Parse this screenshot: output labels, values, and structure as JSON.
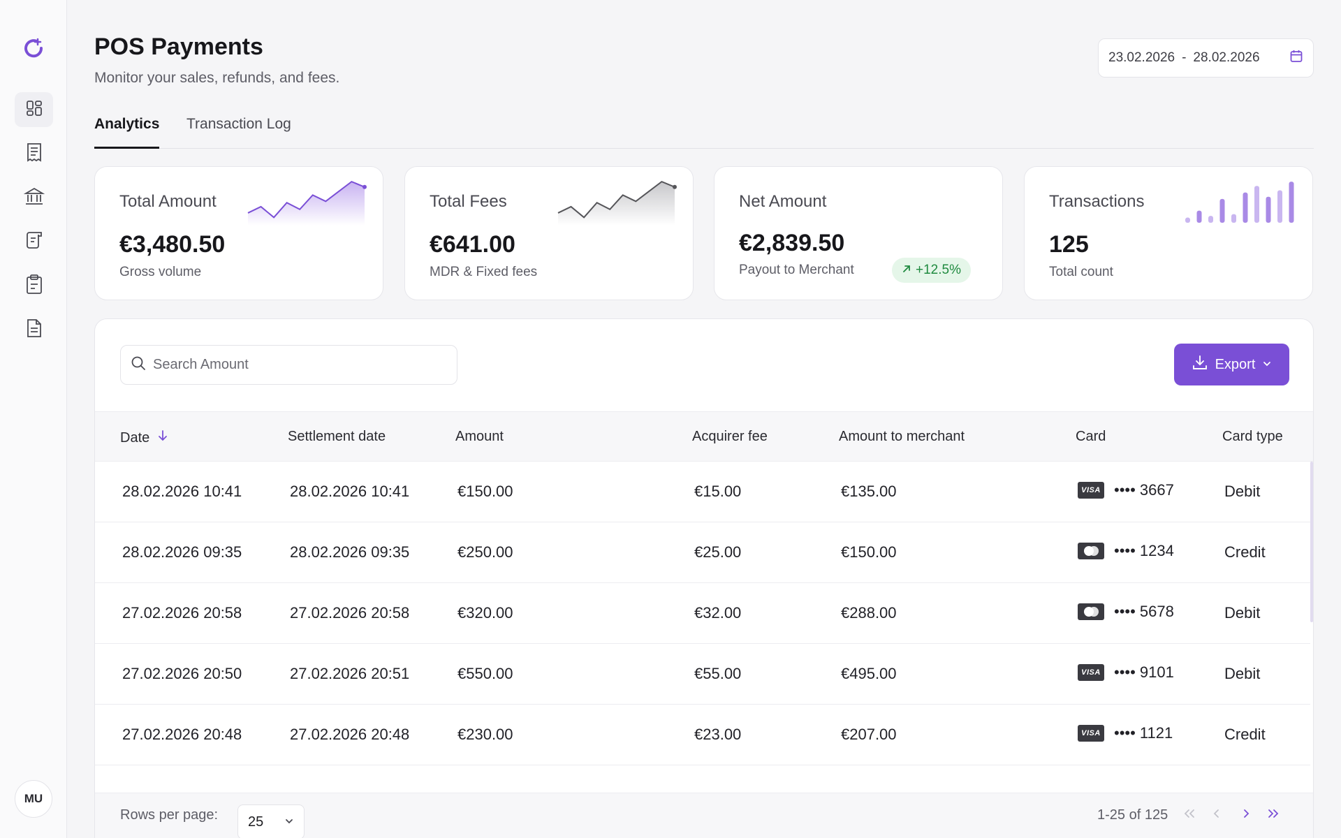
{
  "app": {
    "title": "POS Payments",
    "subtitle": "Monitor your sales, refunds, and fees.",
    "accent": "#7a4fd6"
  },
  "sidebar": {
    "logo_icon": "brand-logo-icon",
    "items": [
      {
        "icon": "dashboard-icon",
        "active": true
      },
      {
        "icon": "receipt-icon",
        "active": false
      },
      {
        "icon": "bank-icon",
        "active": false
      },
      {
        "icon": "scroll-document-icon",
        "active": false
      },
      {
        "icon": "clipboard-icon",
        "active": false
      },
      {
        "icon": "file-text-icon",
        "active": false
      }
    ],
    "avatar": "MU"
  },
  "date_range": {
    "from": "23.02.2026",
    "separator": "-",
    "to": "28.02.2026",
    "icon": "calendar-icon"
  },
  "tabs": [
    {
      "label": "Analytics",
      "active": true
    },
    {
      "label": "Transaction Log",
      "active": false
    }
  ],
  "stats": [
    {
      "label": "Total Amount",
      "value": "€3,480.50",
      "sub": "Gross volume",
      "spark": [
        0.22,
        0.36,
        0.12,
        0.45,
        0.3,
        0.62,
        0.48,
        0.7,
        0.92,
        0.8
      ]
    },
    {
      "label": "Total Fees",
      "value": "€641.00",
      "sub": "MDR & Fixed fees",
      "spark": [
        0.22,
        0.36,
        0.12,
        0.45,
        0.3,
        0.62,
        0.48,
        0.7,
        0.92,
        0.8
      ]
    },
    {
      "label": "Net Amount",
      "value": "€2,839.50",
      "sub": "Payout to Merchant",
      "badge": "+12.5%"
    },
    {
      "label": "Transactions",
      "value": "125",
      "sub": "Total count",
      "bars": [
        0.12,
        0.28,
        0.16,
        0.55,
        0.2,
        0.7,
        0.85,
        0.6,
        0.75,
        0.95
      ]
    }
  ],
  "toolbar": {
    "search_placeholder": "Search Amount",
    "export_label": "Export"
  },
  "table": {
    "columns": [
      "Date",
      "Settlement date",
      "Amount",
      "Acquirer fee",
      "Amount to merchant",
      "Card",
      "Card type"
    ],
    "rows": [
      {
        "date": "28.02.2026 10:41",
        "settlement": "28.02.2026 10:41",
        "amount": "€150.00",
        "fee": "€15.00",
        "merchant": "€135.00",
        "brand": "visa",
        "card": "•••• 3667",
        "type": "Debit"
      },
      {
        "date": "28.02.2026 09:35",
        "settlement": "28.02.2026 09:35",
        "amount": "€250.00",
        "fee": "€25.00",
        "merchant": "€150.00",
        "brand": "mastercard",
        "card": "•••• 1234",
        "type": "Credit"
      },
      {
        "date": "27.02.2026 20:58",
        "settlement": "27.02.2026 20:58",
        "amount": "€320.00",
        "fee": "€32.00",
        "merchant": "€288.00",
        "brand": "mastercard",
        "card": "•••• 5678",
        "type": "Debit"
      },
      {
        "date": "27.02.2026 20:50",
        "settlement": "27.02.2026 20:51",
        "amount": "€550.00",
        "fee": "€55.00",
        "merchant": "€495.00",
        "brand": "visa",
        "card": "•••• 9101",
        "type": "Debit"
      },
      {
        "date": "27.02.2026 20:48",
        "settlement": "27.02.2026 20:48",
        "amount": "€230.00",
        "fee": "€23.00",
        "merchant": "€207.00",
        "brand": "visa",
        "card": "•••• 1121",
        "type": "Credit"
      }
    ]
  },
  "pagination": {
    "rows_per_page_label": "Rows per page:",
    "rows_per_page": "25",
    "range": "1-25 of 125"
  }
}
